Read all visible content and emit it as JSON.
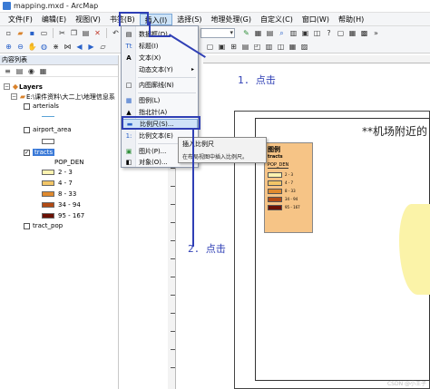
{
  "window": {
    "title": "mapping.mxd - ArcMap"
  },
  "menubar": {
    "items": [
      "文件(F)",
      "编辑(E)",
      "视图(V)",
      "书签(B)",
      "插入(I)",
      "选择(S)",
      "地理处理(G)",
      "自定义(C)",
      "窗口(W)",
      "帮助(H)"
    ]
  },
  "dropdown": {
    "items": [
      {
        "label": "数据框(D)",
        "icon": "data-frame-icon",
        "glyph": "▤"
      },
      {
        "label": "标题(I)",
        "icon": "title-icon",
        "glyph": "Tt"
      },
      {
        "label": "文本(X)",
        "icon": "text-icon",
        "glyph": "A"
      },
      {
        "label": "动态文本(Y)",
        "icon": "dynamic-text-icon",
        "glyph": ""
      },
      {
        "label": "内图廓线(N)",
        "icon": "neatline-icon",
        "glyph": "□"
      },
      {
        "label": "图例(L)",
        "icon": "legend-icon",
        "glyph": "▦"
      },
      {
        "label": "指北针(A)",
        "icon": "north-arrow-icon",
        "glyph": "▲"
      },
      {
        "label": "比例尺(S)...",
        "icon": "scale-bar-icon",
        "glyph": "▬"
      },
      {
        "label": "比例文本(E)",
        "icon": "scale-text-icon",
        "glyph": "1:"
      },
      {
        "label": "图片(P)...",
        "icon": "picture-icon",
        "glyph": "▣"
      },
      {
        "label": "对象(O)...",
        "icon": "object-icon",
        "glyph": "◧"
      }
    ],
    "submenu_arrow": "▸"
  },
  "tooltip": {
    "title": "插入比例尺",
    "description": "在布局视图中插入比例尺。"
  },
  "toc": {
    "header": "内容列表",
    "root": "Layers",
    "path": "E:\\课件资料\\大二上\\地理信息系",
    "layers": [
      {
        "name": "arterials",
        "checked": false
      },
      {
        "name": "airport_area",
        "checked": false
      },
      {
        "name": "tracts",
        "checked": true
      },
      {
        "name": "tract_pop",
        "checked": false
      }
    ],
    "field": "POP_DEN",
    "classes": [
      {
        "label": "2 - 3",
        "color": "#fdf3b0"
      },
      {
        "label": "4 - 7",
        "color": "#f3c667"
      },
      {
        "label": "8 - 33",
        "color": "#e08a2e"
      },
      {
        "label": "34 - 94",
        "color": "#b14a14"
      },
      {
        "label": "95 - 167",
        "color": "#6b1003"
      }
    ]
  },
  "layout": {
    "map_title": "**机场附近的",
    "legend": {
      "title": "图例",
      "layer": "tracts",
      "field": "POP_DEN",
      "rows": [
        {
          "label": "2 - 3",
          "color": "#fdf3b0"
        },
        {
          "label": "4 - 7",
          "color": "#f3c667"
        },
        {
          "label": "8 - 33",
          "color": "#e08a2e"
        },
        {
          "label": "34 - 94",
          "color": "#b14a14"
        },
        {
          "label": "95 - 167",
          "color": "#6b1003"
        }
      ]
    }
  },
  "annotations": {
    "step1": "1. 点击",
    "step2": "2. 点击"
  },
  "watermark": "CSDN @小王子",
  "colors": {
    "annotation": "#2f3fb5",
    "selection": "#3b7ad8",
    "legend_bg": "#f6c486"
  }
}
